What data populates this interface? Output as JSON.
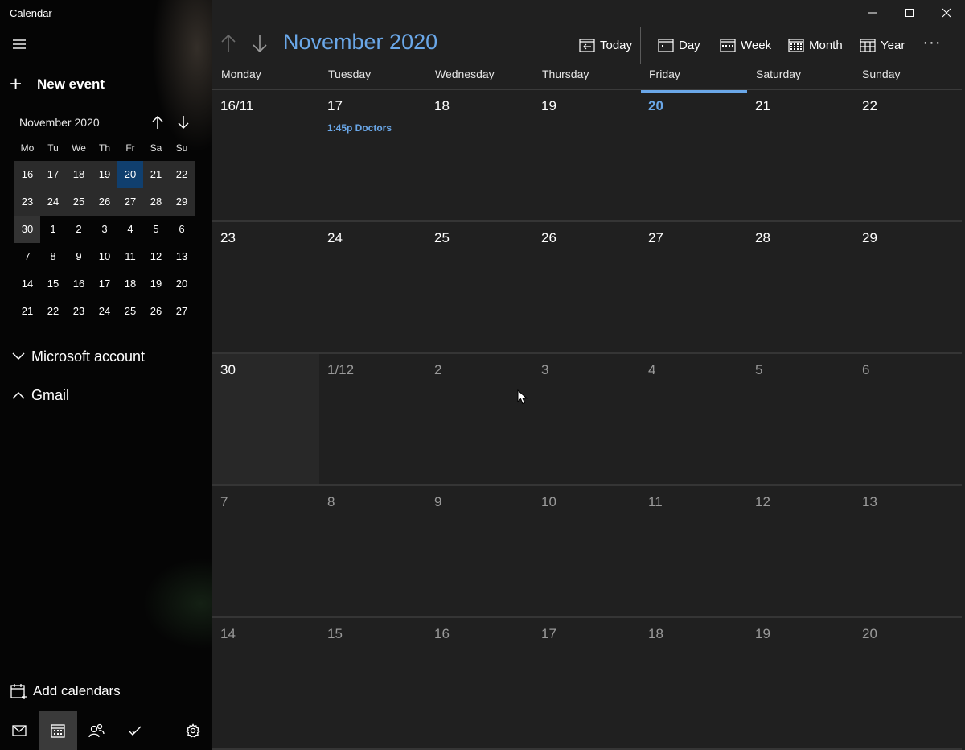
{
  "app": {
    "title": "Calendar"
  },
  "sidebar": {
    "new_event_label": "New event",
    "mini_calendar": {
      "month_label": "November 2020",
      "day_headers": [
        "Mo",
        "Tu",
        "We",
        "Th",
        "Fr",
        "Sa",
        "Su"
      ],
      "weeks": [
        [
          "16",
          "17",
          "18",
          "19",
          "20",
          "21",
          "22"
        ],
        [
          "23",
          "24",
          "25",
          "26",
          "27",
          "28",
          "29"
        ],
        [
          "30",
          "1",
          "2",
          "3",
          "4",
          "5",
          "6"
        ],
        [
          "7",
          "8",
          "9",
          "10",
          "11",
          "12",
          "13"
        ],
        [
          "14",
          "15",
          "16",
          "17",
          "18",
          "19",
          "20"
        ],
        [
          "21",
          "22",
          "23",
          "24",
          "25",
          "26",
          "27"
        ]
      ]
    },
    "accounts": [
      {
        "label": "Microsoft account",
        "expanded": false
      },
      {
        "label": "Gmail",
        "expanded": true
      }
    ],
    "add_calendars_label": "Add calendars",
    "bottom_nav": [
      "mail-icon",
      "calendar-icon",
      "people-icon",
      "todo-icon",
      "settings-icon"
    ]
  },
  "toolbar": {
    "title": "November 2020",
    "today_label": "Today",
    "day_label": "Day",
    "week_label": "Week",
    "month_label": "Month",
    "year_label": "Year",
    "more_label": "···"
  },
  "month_view": {
    "day_headers": [
      "Monday",
      "Tuesday",
      "Wednesday",
      "Thursday",
      "Friday",
      "Saturday",
      "Sunday"
    ],
    "weeks": [
      [
        "16/11",
        "17",
        "18",
        "19",
        "20",
        "21",
        "22"
      ],
      [
        "23",
        "24",
        "25",
        "26",
        "27",
        "28",
        "29"
      ],
      [
        "30",
        "1/12",
        "2",
        "3",
        "4",
        "5",
        "6"
      ],
      [
        "7",
        "8",
        "9",
        "10",
        "11",
        "12",
        "13"
      ],
      [
        "14",
        "15",
        "16",
        "17",
        "18",
        "19",
        "20"
      ]
    ],
    "events": {
      "0-1": {
        "label": "1:45p Doctors"
      }
    },
    "today_label": "20"
  },
  "colors": {
    "accent": "#6aa7e8",
    "today_bg": "#103f6e",
    "background": "#202020",
    "sidebar_bg": "#050505"
  }
}
